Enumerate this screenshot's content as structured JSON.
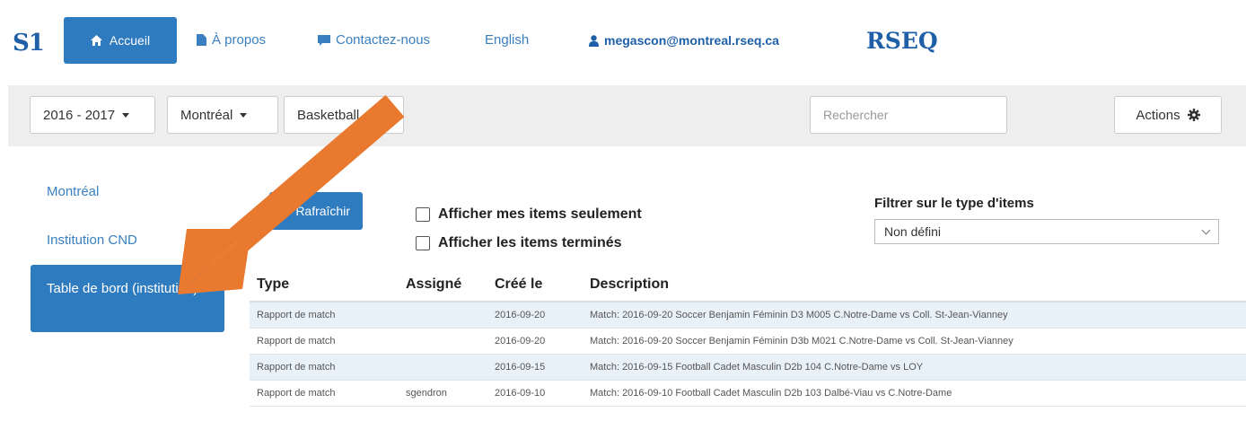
{
  "navbar": {
    "brand_left": "S1",
    "home_label": "Accueil",
    "about_label": "À propos",
    "contact_label": "Contactez-nous",
    "language_label": "English",
    "user_email": "megascon@montreal.rseq.ca",
    "brand_right": "RSEQ"
  },
  "filters": {
    "season": "2016 - 2017",
    "region": "Montréal",
    "sport": "Basketball",
    "search_placeholder": "Rechercher",
    "actions_label": "Actions"
  },
  "sidebar": {
    "items": [
      {
        "label": "Montréal"
      },
      {
        "label": "Institution CND"
      },
      {
        "label": "Table de bord (institution)",
        "active": true
      }
    ]
  },
  "main": {
    "refresh_label": "Rafraîchir",
    "checkbox_mine": "Afficher mes items seulement",
    "checkbox_done": "Afficher les items terminés",
    "type_filter_label": "Filtrer sur le type d'items",
    "type_filter_value": "Non défini"
  },
  "table": {
    "headers": [
      "Type",
      "Assigné",
      "Créé le",
      "Description"
    ],
    "rows": [
      {
        "type": "Rapport de match",
        "assigned": "",
        "created": "2016-09-20",
        "description": "Match: 2016-09-20 Soccer Benjamin Féminin D3 M005 C.Notre-Dame vs Coll. St-Jean-Vianney"
      },
      {
        "type": "Rapport de match",
        "assigned": "",
        "created": "2016-09-20",
        "description": "Match: 2016-09-20 Soccer Benjamin Féminin D3b M021 C.Notre-Dame vs Coll. St-Jean-Vianney"
      },
      {
        "type": "Rapport de match",
        "assigned": "",
        "created": "2016-09-15",
        "description": "Match: 2016-09-15 Football Cadet Masculin D2b 104 C.Notre-Dame vs LOY"
      },
      {
        "type": "Rapport de match",
        "assigned": "sgendron",
        "created": "2016-09-10",
        "description": "Match: 2016-09-10 Football Cadet Masculin D2b 103 Dalbé-Viau vs C.Notre-Dame"
      }
    ]
  },
  "colors": {
    "primary": "#2f7bbf",
    "brand": "#1f5fa8",
    "annotation_arrow": "#e8792e"
  }
}
